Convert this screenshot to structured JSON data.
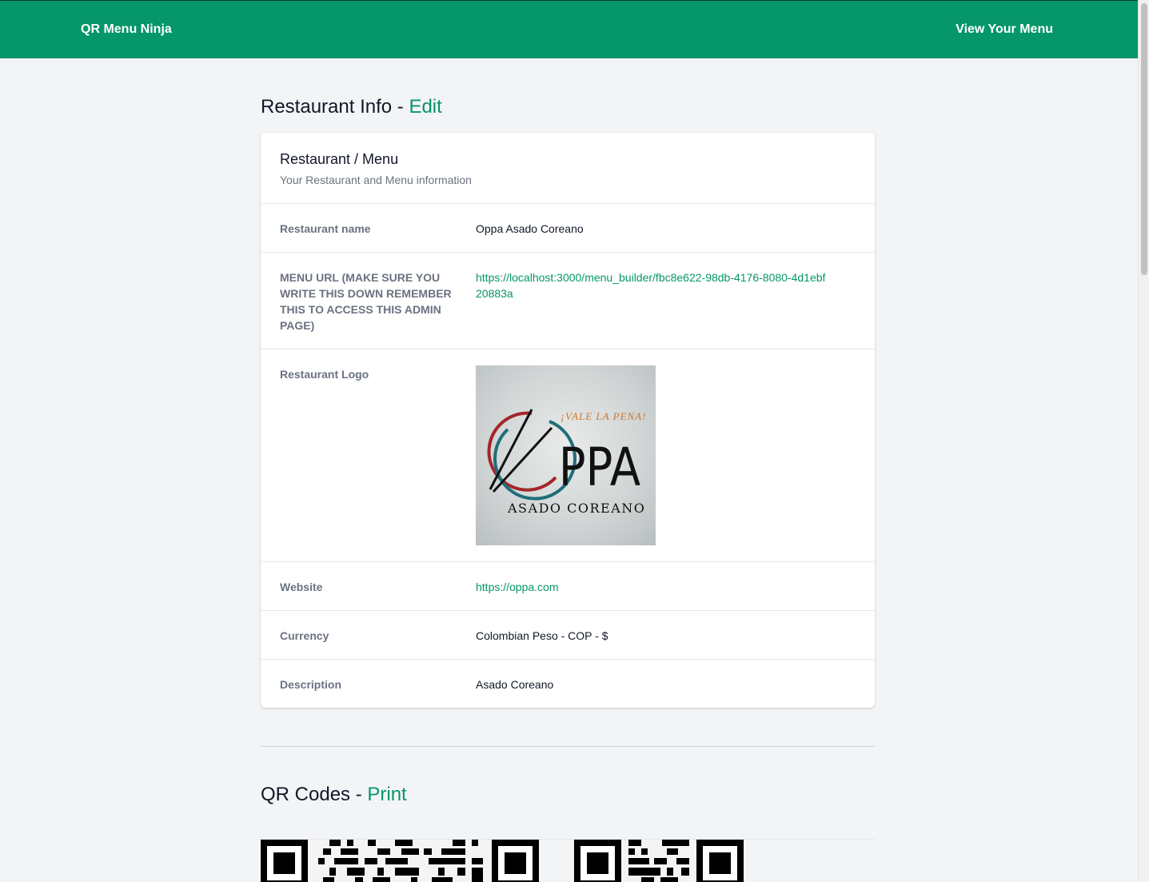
{
  "header": {
    "brand": "QR Menu Ninja",
    "view_menu": "View Your Menu"
  },
  "info_section": {
    "title": "Restaurant Info - ",
    "action": "Edit"
  },
  "card": {
    "title": "Restaurant / Menu",
    "subtitle": "Your Restaurant and Menu information",
    "rows": [
      {
        "label": "Restaurant name",
        "value": "Oppa Asado Coreano"
      },
      {
        "label": "Menu URL (MAKE SURE YOU WRITE THIS DOWN REMEMBER THIS TO ACCESS THIS ADMIN PAGE)",
        "value": "https://localhost:3000/menu_builder/fbc8e622-98db-4176-8080-4d1ebf20883a"
      },
      {
        "label": "Restaurant Logo",
        "value": ""
      },
      {
        "label": "Website",
        "value": "https://oppa.com"
      },
      {
        "label": "Currency",
        "value": "Colombian Peso - COP - $"
      },
      {
        "label": "Description",
        "value": "Asado Coreano"
      }
    ]
  },
  "logo": {
    "tagline": "¡VALE LA PENA!",
    "wordmark": "PPA",
    "subtitle": "ASADO COREANO"
  },
  "qr_section": {
    "title": "QR Codes - ",
    "action": "Print"
  },
  "colors": {
    "brand_green": "#059669",
    "background": "#f3f4f6"
  }
}
